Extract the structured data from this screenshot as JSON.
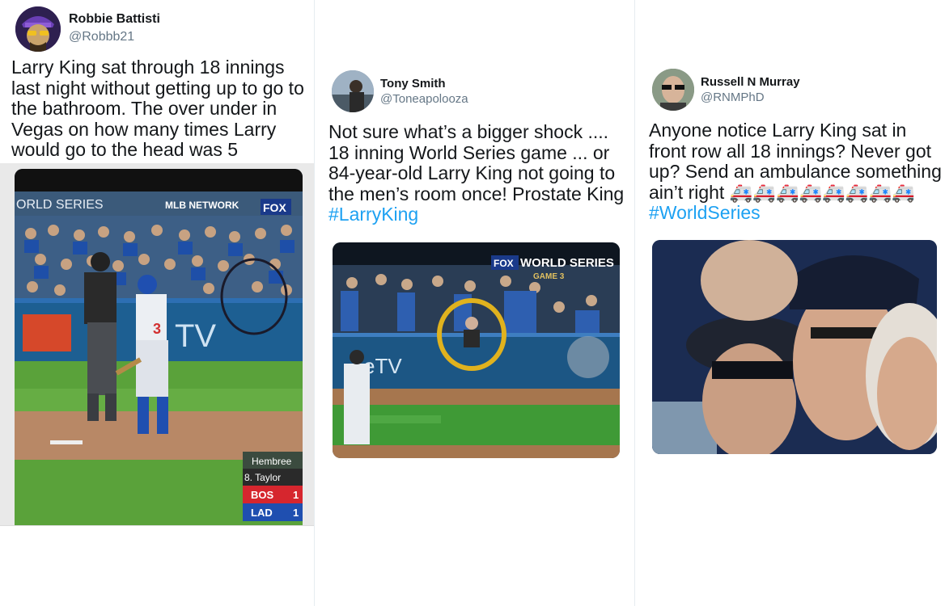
{
  "tweets": [
    {
      "name": "Robbie Battisti",
      "handle": "@Robbb21",
      "text": "Larry King sat through 18 innings last night without getting up to go to the bathroom. The over under in Vegas on how many times Larry would go to the head was 5",
      "media": {
        "banner_left": "ORLD SERIES",
        "banner_network": "MLB NETWORK",
        "banner_fox": "FOX",
        "ad_text": "TV",
        "player_number": "3",
        "scoreboard": {
          "pitcher": "Hembree",
          "batter": "8. Taylor",
          "team1": "BOS",
          "score1": "1",
          "team2": "LAD",
          "score2": "1"
        }
      }
    },
    {
      "name": "Tony Smith",
      "handle": "@Toneapolooza",
      "text_plain": "Not sure what’s a bigger shock .... 18 inning World Series game ... or 84-year-old Larry King not going to the men’s room once! Prostate King ",
      "hashtag": "#LarryKing",
      "media": {
        "fox_logo": "FOX",
        "title": "WORLD SERIES",
        "subtitle": "GAME 3",
        "ad_text": "eTV"
      }
    },
    {
      "name": "Russell N Murray",
      "handle": "@RNMPhD",
      "text_plain": "Anyone notice Larry King sat in front row all 18 innings? Never got up? Send an ambulance something ain’t right 🚑🚑🚑🚑🚑🚑🚑🚑",
      "hashtag": "#WorldSeries"
    }
  ],
  "colors": {
    "link": "#1da1f2",
    "name": "#14171a",
    "handle": "#657786"
  }
}
